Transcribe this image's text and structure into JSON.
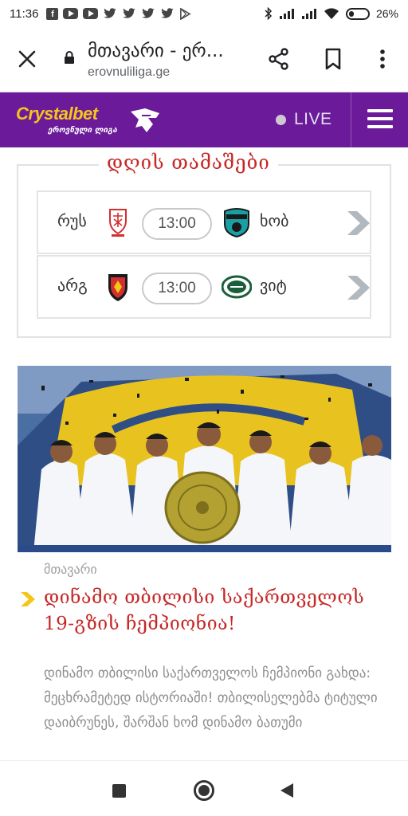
{
  "status_bar": {
    "time": "11:36",
    "battery": "26%",
    "notification_icons": [
      "facebook-icon",
      "youtube-icon",
      "youtube-icon",
      "twitter-icon",
      "twitter-icon",
      "twitter-icon",
      "twitter-icon",
      "play-store-icon"
    ],
    "system_icons": [
      "bluetooth-icon",
      "signal-icon",
      "signal-icon",
      "wifi-icon",
      "battery-icon"
    ]
  },
  "browser": {
    "page_title": "მთავარი - ერ...",
    "url": "erovnuliliga.ge"
  },
  "site_header": {
    "logo_text": "Crystalbet",
    "logo_subtitle": "ეროვნული ლიგა",
    "live_label": "LIVE",
    "colors": {
      "header_bg": "#6b1b9a",
      "logo_yellow": "#f5c518"
    }
  },
  "games": {
    "title": "დღის თამაშები",
    "matches": [
      {
        "home": "რუს",
        "time": "13:00",
        "away": "ხობ"
      },
      {
        "home": "არგ",
        "time": "13:00",
        "away": "ვიტ"
      }
    ]
  },
  "article": {
    "category": "მთავარი",
    "headline": "დინამო თბილისი საქართველოს 19-გზის ჩემპიონია!",
    "excerpt": "დინამო თბილისი საქართველოს ჩემპიონი გახდა: მეცხრამეტედ ისტორიაში! თბილისელებმა ტიტული დაიბრუნეს, შარშან ხომ დინამო ბათუმი",
    "accent_color": "#c62828"
  }
}
